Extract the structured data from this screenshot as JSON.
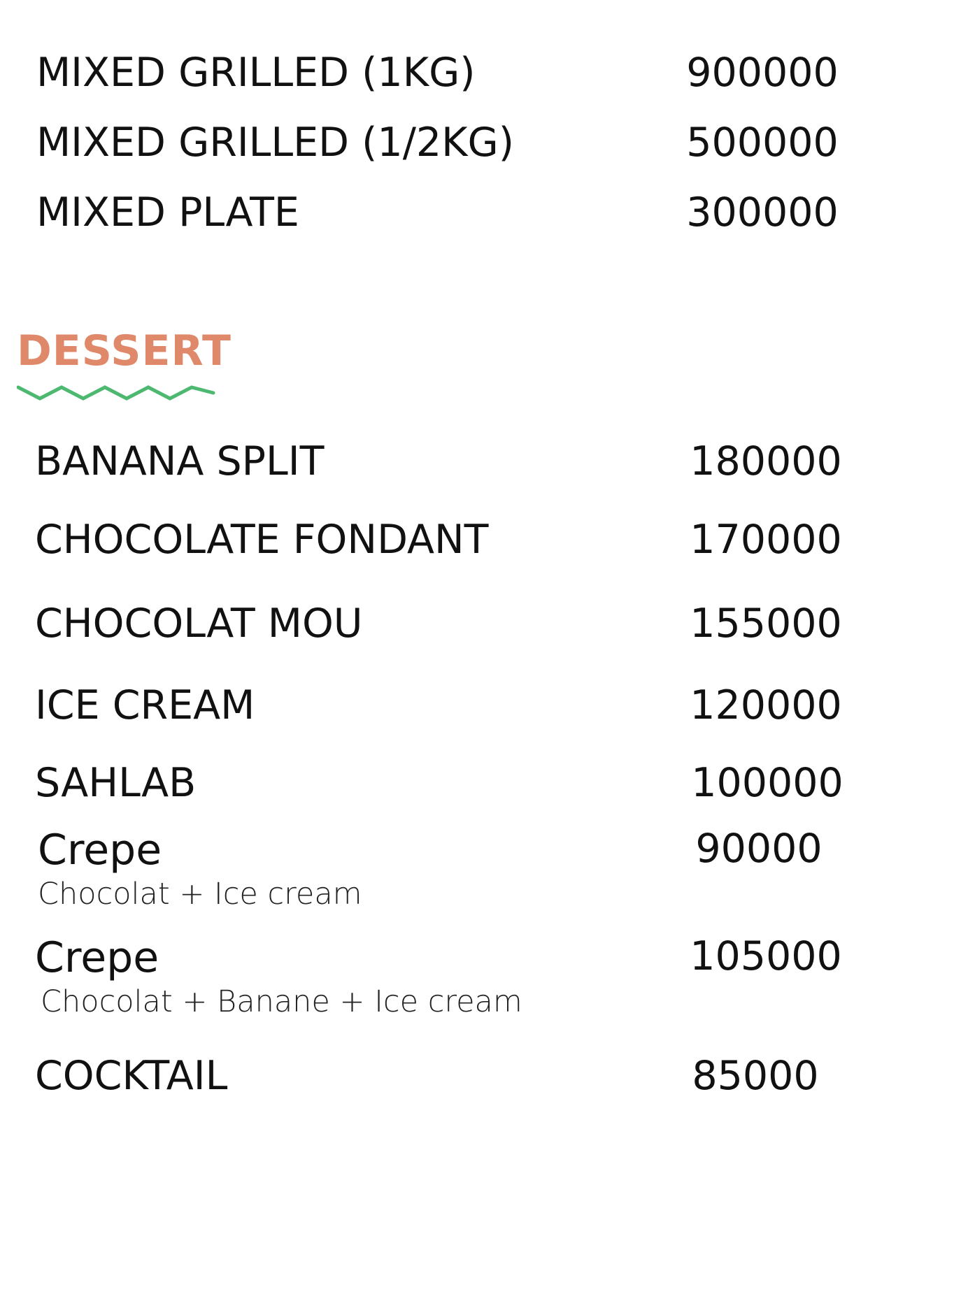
{
  "colors": {
    "text": "#111111",
    "section_title": "#E0886A",
    "squiggle": "#4DB870"
  },
  "top_items": [
    {
      "name": "MIXED GRILLED (1KG)",
      "price": "900000"
    },
    {
      "name": "MIXED GRILLED (1/2KG)",
      "price": "500000"
    },
    {
      "name": "MIXED PLATE",
      "price": "300000"
    }
  ],
  "dessert": {
    "title": "DESSERT",
    "items": [
      {
        "name": "BANANA SPLIT",
        "price": "180000"
      },
      {
        "name": "CHOCOLATE FONDANT",
        "price": "170000"
      },
      {
        "name": "CHOCOLAT MOU",
        "price": "155000"
      },
      {
        "name": "ICE CREAM",
        "price": "120000"
      },
      {
        "name": "SAHLAB",
        "price": "100000"
      },
      {
        "name": "Crepe",
        "description": "Chocolat + Ice cream",
        "price": "90000"
      },
      {
        "name": "Crepe",
        "description": "Chocolat + Banane + Ice cream",
        "price": "105000"
      },
      {
        "name": "COCKTAIL",
        "price": "85000"
      }
    ]
  }
}
